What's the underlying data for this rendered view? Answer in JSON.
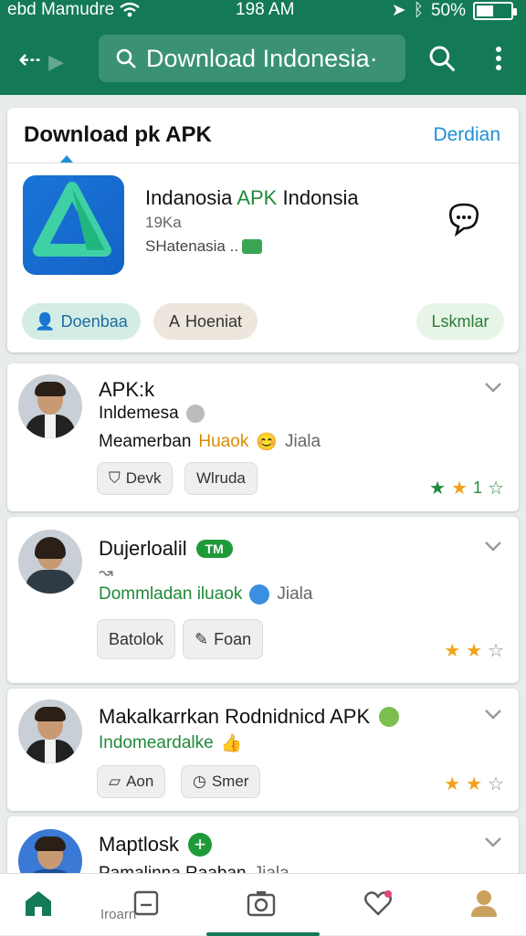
{
  "status": {
    "carrier": "ebd Mamudre",
    "time": "198 AM",
    "battery": "50%",
    "battery_level": 0.5
  },
  "toolbar": {
    "search_text": "Download Indonesia·"
  },
  "featured": {
    "title": "Download pk APK",
    "link": "Derdian",
    "app_name_a": "Indanosia",
    "app_name_b": "APK",
    "app_name_c": "Indonsia",
    "size": "19Ka",
    "developer": "SHatenasia ..",
    "buttons": [
      "Doenbaa",
      "Hoeniat",
      "Lskmlar"
    ]
  },
  "items": [
    {
      "name": "APK:k",
      "line2": "Inldemesa",
      "line3a": "Meamerban",
      "line3b": "Huaok",
      "line3c": "Jiala",
      "chips": [
        "Devk",
        "Wlruda"
      ],
      "rating": 1,
      "rating_label": "1"
    },
    {
      "name": "Dujerloalil",
      "badge": "TM",
      "line2": "",
      "line3a": "Dommladan iluaok",
      "line3c": "Jiala",
      "chips": [
        "Batolok",
        "Foan"
      ],
      "rating": 2
    },
    {
      "name": "Makalkarrkan Rodnidnicd APK",
      "line2": "Indomeardalke",
      "chips": [
        "Aon",
        "Smer"
      ],
      "rating": 2
    },
    {
      "name": "Maptlosk",
      "line2": "Pamalinna Raaban",
      "line2c": "Jiala"
    }
  ],
  "bottom_nav": {
    "label": "Iroarn"
  },
  "colors": {
    "appbar": "#137a55",
    "accent_green": "#1f8a3a",
    "link_blue": "#1e8fd6",
    "star": "#f2a21b"
  },
  "icons": [
    "back-arrow-icon",
    "search-icon",
    "more-vert-icon",
    "chat-icon",
    "home-icon",
    "book-icon",
    "camera-icon",
    "heart-icon",
    "profile-icon"
  ]
}
